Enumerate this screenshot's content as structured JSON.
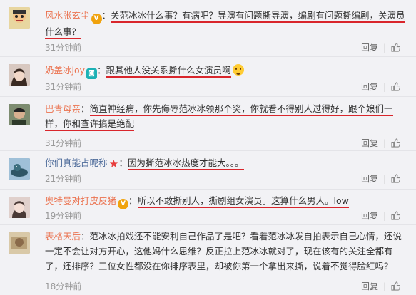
{
  "comments": [
    {
      "user": "风水张玄尘",
      "name_color": "#eb7350",
      "badge": "vip",
      "text": "关范冰冰什么事？有病吧？导演有问题撕导演，编剧有问题撕编剧，关演员什么事？",
      "time": "31分钟前",
      "reply": "回复",
      "avatar_color": "#c8b070"
    },
    {
      "user": "奶盖冰joy",
      "name_color": "#eb7350",
      "badge": "camera",
      "text": "跟其他人没关系撕什么女演员啊",
      "emoji": "smirk-emoji",
      "time": "31分钟前",
      "reply": "回复",
      "avatar_color": "#8a7266"
    },
    {
      "user": "巴青母亲",
      "name_color": "#eb7350",
      "text": "简直神经病，你先侮辱范冰冰领那个奖，你就看不得别人过得好，跟个娘们一样，你和查许搞是绝配",
      "time": "31分钟前",
      "reply": "回复",
      "avatar_color": "#5e6b57"
    },
    {
      "user": "你们真能占昵称",
      "name_color": "#4d6b9a",
      "badge": "star",
      "text": "因为撕范冰冰热度才能大。。。",
      "time": "21分钟前",
      "reply": "回复",
      "avatar_color": "#2f5a7a"
    },
    {
      "user": "奥特曼对打皮皮猪",
      "name_color": "#eb7350",
      "badge": "vip",
      "text": "所以不敢撕别人，撕剧组女演员。这算什么男人。low",
      "time": "19分钟前",
      "reply": "回复",
      "avatar_color": "#b89a8c"
    },
    {
      "user": "表格天后",
      "name_color": "#eb7350",
      "text": "范冰冰拍戏还不能安利自己作品了是吧？看着范冰冰发自拍表示自己心情，还说一定不会让对方开心，这他妈什么思维？反正拉上范冰冰就对了，现在该有的关注全都有了，还排序？三位女性都没在你排序表里，却被你第一个拿出来撕，说着不觉得脸红吗？",
      "time": "18分钟前",
      "reply": "回复",
      "avatar_color": "#a89070"
    }
  ],
  "icons": {
    "like": "thumbs-up-icon"
  },
  "colors": {
    "highlight_underline": "#d9262c",
    "username": "#eb7350"
  }
}
